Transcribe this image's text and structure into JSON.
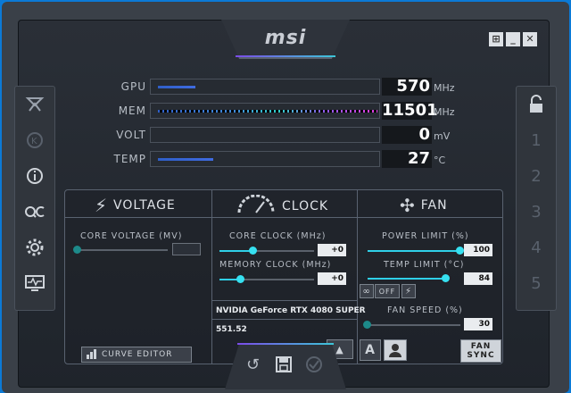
{
  "window": {
    "logo": "msi",
    "min_icon": "_",
    "close_icon": "✕",
    "win_icon": "⊞"
  },
  "sidebar_left": [
    "afterburner-icon",
    "k-icon",
    "info-icon",
    "oc-scanner-icon",
    "settings-icon",
    "monitor-icon"
  ],
  "sidebar_right": {
    "lock_icon": "lock",
    "profiles": [
      "1",
      "2",
      "3",
      "4",
      "5"
    ]
  },
  "metrics": [
    {
      "label": "GPU",
      "value": "570",
      "unit": "MHz"
    },
    {
      "label": "MEM",
      "value": "11501",
      "unit": "MHz"
    },
    {
      "label": "VOLT",
      "value": "0",
      "unit": "mV"
    },
    {
      "label": "TEMP",
      "value": "27",
      "unit": "°C"
    }
  ],
  "voltage": {
    "title": "VOLTAGE",
    "core_voltage_label": "CORE VOLTAGE (MV)",
    "curve_editor": "CURVE EDITOR"
  },
  "clock": {
    "title": "CLOCK",
    "core_clock_label": "CORE CLOCK (MHz)",
    "core_clock_value": "+0",
    "memory_clock_label": "MEMORY CLOCK (MHz)",
    "memory_clock_value": "+0",
    "gpu_name": "NVIDIA GeForce RTX 4080 SUPER",
    "driver": "551.52"
  },
  "fan": {
    "title": "FAN",
    "power_limit_label": "POWER LIMIT (%)",
    "power_limit_value": "100",
    "temp_limit_label": "TEMP LIMIT (°C)",
    "temp_limit_value": "84",
    "link_off": "OFF",
    "fan_speed_label": "FAN SPEED (%)",
    "fan_speed_value": "30",
    "auto_label": "A",
    "fan_sync": "FAN SYNC"
  },
  "colors": {
    "accent": "#36e0f0",
    "brand_purple": "#7b4ce8",
    "background": "#1f242b"
  }
}
